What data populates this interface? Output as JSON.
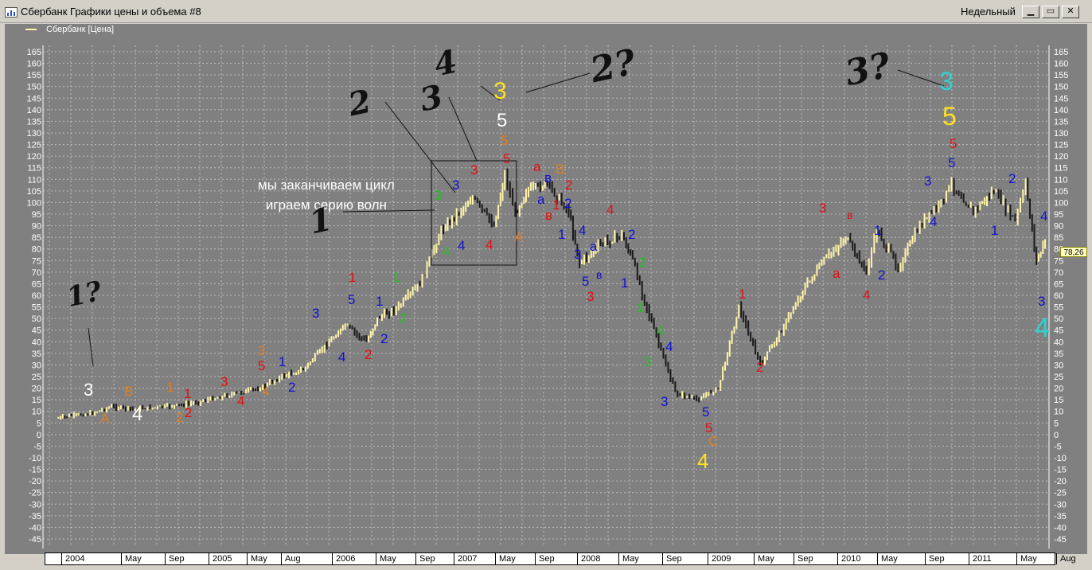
{
  "window": {
    "title": "Сбербанк Графики цены и объема #8",
    "period": "Недельный",
    "buttons": [
      "minimize-button",
      "restore-button",
      "close-button"
    ]
  },
  "legend": {
    "label": "Сбербанк [Цена]",
    "color": "#fff4a8"
  },
  "last_price": "78,26",
  "comment": {
    "line1": "мы заканчиваем цикл",
    "line2": "играем серию волн"
  },
  "x_axis": [
    "2004",
    "May",
    "Sep",
    "2005",
    "May",
    "Aug",
    "2006",
    "May",
    "Sep",
    "2007",
    "May",
    "Sep",
    "2008",
    "May",
    "Sep",
    "2009",
    "May",
    "Sep",
    "2010",
    "May",
    "Sep",
    "2011",
    "May",
    "Aug"
  ],
  "chart_data": {
    "type": "line",
    "title": "",
    "xlabel": "",
    "ylabel": "",
    "ylim": [
      -45,
      165
    ],
    "y_ticks": [
      165,
      160,
      155,
      150,
      145,
      140,
      135,
      130,
      125,
      120,
      115,
      110,
      105,
      100,
      95,
      90,
      85,
      80,
      75,
      70,
      65,
      60,
      55,
      50,
      45,
      40,
      35,
      30,
      25,
      20,
      15,
      10,
      5,
      0,
      -5,
      -10,
      -15,
      -20,
      -25,
      -30,
      -35,
      -40,
      -45
    ],
    "grid": true,
    "series": [
      {
        "name": "Сбербанк [Цена]",
        "x": [
          "2003-12",
          "2004-01",
          "2004-03",
          "2004-05",
          "2004-07",
          "2004-10",
          "2004-12",
          "2005-03",
          "2005-05",
          "2005-07",
          "2005-09",
          "2005-11",
          "2006-01",
          "2006-03",
          "2006-05",
          "2006-06",
          "2006-08",
          "2006-10",
          "2006-12",
          "2007-01",
          "2007-03",
          "2007-05",
          "2007-06",
          "2007-07",
          "2007-08",
          "2007-10",
          "2007-12",
          "2008-01",
          "2008-03",
          "2008-05",
          "2008-06",
          "2008-08",
          "2008-10",
          "2008-12",
          "2009-02",
          "2009-04",
          "2009-06",
          "2009-08",
          "2009-10",
          "2009-12",
          "2010-02",
          "2010-04",
          "2010-05",
          "2010-07",
          "2010-09",
          "2010-11",
          "2010-12",
          "2011-02",
          "2011-04",
          "2011-06",
          "2011-07",
          "2011-08",
          "2011-09"
        ],
        "values": [
          7,
          8,
          9,
          12,
          11,
          12,
          13,
          16,
          18,
          20,
          25,
          28,
          38,
          47,
          40,
          50,
          55,
          65,
          88,
          93,
          102,
          90,
          112,
          95,
          105,
          108,
          96,
          74,
          82,
          86,
          75,
          45,
          18,
          15,
          20,
          55,
          30,
          45,
          62,
          75,
          85,
          70,
          88,
          72,
          90,
          100,
          108,
          96,
          105,
          92,
          108,
          75,
          85
        ]
      }
    ],
    "annotations": [
      {
        "text": "1?",
        "color": "#111111",
        "note": "handwritten"
      },
      {
        "text": "3",
        "color": "#ffffff"
      },
      {
        "text": "4",
        "color": "#ffffff"
      },
      {
        "text": "A",
        "color": "#e07f20"
      },
      {
        "text": "B",
        "color": "#e07f20"
      },
      {
        "text": "1",
        "color": "#e07f20"
      },
      {
        "text": "2",
        "color": "#e07f20"
      },
      {
        "text": "1",
        "color": "#e01010"
      },
      {
        "text": "2",
        "color": "#e01010"
      },
      {
        "text": "3",
        "color": "#e01010"
      },
      {
        "text": "4",
        "color": "#e01010"
      },
      {
        "text": "3",
        "color": "#e07f20"
      },
      {
        "text": "5",
        "color": "#e01010"
      },
      {
        "text": "4",
        "color": "#e07f20"
      },
      {
        "text": "1",
        "color": "#1010d0"
      },
      {
        "text": "2",
        "color": "#1010d0"
      },
      {
        "text": "3",
        "color": "#1010d0"
      },
      {
        "text": "4",
        "color": "#1010d0"
      },
      {
        "text": "5",
        "color": "#1010d0"
      },
      {
        "text": "1",
        "color": "#e01010"
      },
      {
        "text": "2",
        "color": "#e01010"
      },
      {
        "text": "1",
        "color": "#1010d0"
      },
      {
        "text": "2",
        "color": "#1010d0"
      },
      {
        "text": "1",
        "color": "#20c020"
      },
      {
        "text": "2",
        "color": "#20c020"
      },
      {
        "text": "3",
        "color": "#20c020"
      },
      {
        "text": "4",
        "color": "#20c020"
      },
      {
        "text": "3",
        "color": "#1010d0"
      },
      {
        "text": "4",
        "color": "#1010d0"
      },
      {
        "text": "3",
        "color": "#e01010"
      },
      {
        "text": "4",
        "color": "#e01010"
      },
      {
        "text": "5",
        "color": "#e01010"
      },
      {
        "text": "5",
        "color": "#e07f20"
      },
      {
        "text": "5",
        "color": "#ffffff"
      },
      {
        "text": "3",
        "color": "#ffe020"
      },
      {
        "text": "A",
        "color": "#e07f20"
      },
      {
        "text": "a",
        "color": "#e01010"
      },
      {
        "text": "B",
        "color": "#e07f20"
      },
      {
        "text": "в",
        "color": "#1010d0"
      },
      {
        "text": "a",
        "color": "#1010d0"
      },
      {
        "text": "в",
        "color": "#e01010"
      },
      {
        "text": "1",
        "color": "#e01010"
      },
      {
        "text": "2",
        "color": "#e01010"
      },
      {
        "text": "2",
        "color": "#1010d0"
      },
      {
        "text": "1",
        "color": "#1010d0"
      },
      {
        "text": "4",
        "color": "#1010d0"
      },
      {
        "text": "3",
        "color": "#1010d0"
      },
      {
        "text": "a",
        "color": "#1010d0"
      },
      {
        "text": "5",
        "color": "#1010d0"
      },
      {
        "text": "в",
        "color": "#1010d0"
      },
      {
        "text": "3",
        "color": "#e01010"
      },
      {
        "text": "4",
        "color": "#e01010"
      },
      {
        "text": "2",
        "color": "#1010d0"
      },
      {
        "text": "1",
        "color": "#1010d0"
      },
      {
        "text": "2",
        "color": "#20c020"
      },
      {
        "text": "1",
        "color": "#20c020"
      },
      {
        "text": "4",
        "color": "#20c020"
      },
      {
        "text": "3",
        "color": "#20c020"
      },
      {
        "text": "4",
        "color": "#1010d0"
      },
      {
        "text": "3",
        "color": "#1010d0"
      },
      {
        "text": "5",
        "color": "#1010d0"
      },
      {
        "text": "5",
        "color": "#e01010"
      },
      {
        "text": "C",
        "color": "#e07f20"
      },
      {
        "text": "4",
        "color": "#ffe020"
      },
      {
        "text": "1",
        "color": "#e01010"
      },
      {
        "text": "2",
        "color": "#e01010"
      },
      {
        "text": "3",
        "color": "#e01010"
      },
      {
        "text": "в",
        "color": "#e01010"
      },
      {
        "text": "a",
        "color": "#e01010"
      },
      {
        "text": "4",
        "color": "#e01010"
      },
      {
        "text": "1",
        "color": "#1010d0"
      },
      {
        "text": "2",
        "color": "#1010d0"
      },
      {
        "text": "3",
        "color": "#1010d0"
      },
      {
        "text": "4",
        "color": "#1010d0"
      },
      {
        "text": "5",
        "color": "#1010d0"
      },
      {
        "text": "5",
        "color": "#e01010"
      },
      {
        "text": "5",
        "color": "#ffe020"
      },
      {
        "text": "3",
        "color": "#30d0d0"
      },
      {
        "text": "2",
        "color": "#1010d0"
      },
      {
        "text": "1",
        "color": "#1010d0"
      },
      {
        "text": "4",
        "color": "#1010d0"
      },
      {
        "text": "3",
        "color": "#1010d0"
      },
      {
        "text": "4",
        "color": "#30d0d0"
      },
      {
        "text": "1",
        "color": "#111111",
        "note": "handwritten"
      },
      {
        "text": "2",
        "color": "#111111",
        "note": "handwritten"
      },
      {
        "text": "3",
        "color": "#111111",
        "note": "handwritten"
      },
      {
        "text": "4",
        "color": "#111111",
        "note": "handwritten"
      },
      {
        "text": "2?",
        "color": "#111111",
        "note": "handwritten"
      },
      {
        "text": "3?",
        "color": "#111111",
        "note": "handwritten"
      }
    ]
  }
}
